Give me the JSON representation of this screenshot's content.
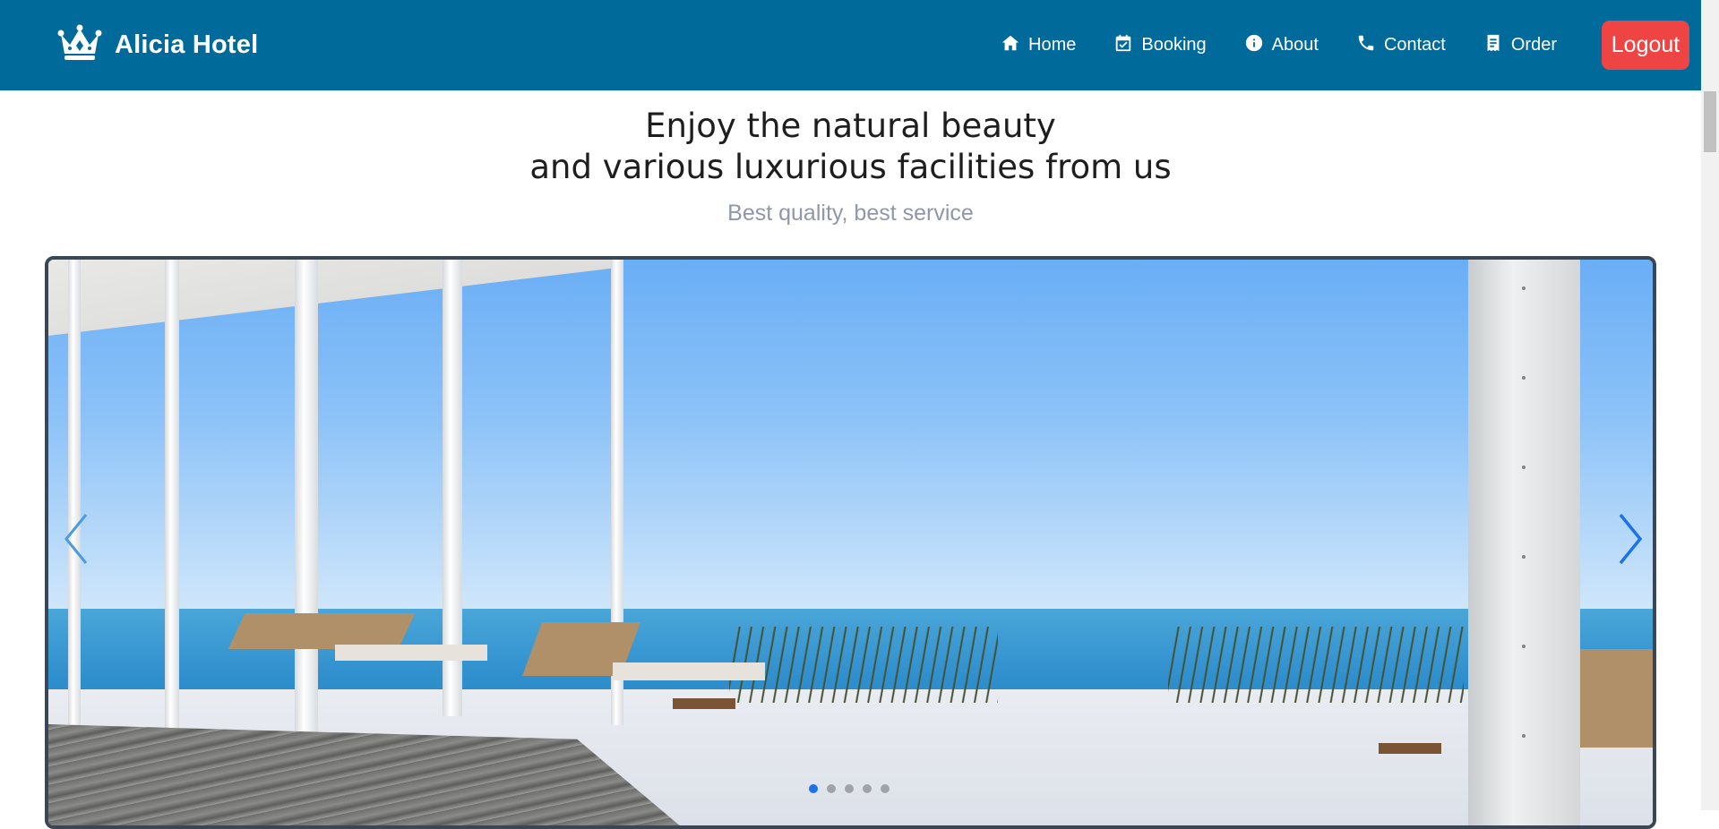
{
  "brand": {
    "name": "Alicia Hotel",
    "logo_icon": "crown-icon"
  },
  "nav": {
    "items": [
      {
        "label": "Home",
        "icon": "home-icon"
      },
      {
        "label": "Booking",
        "icon": "calendar-check-icon"
      },
      {
        "label": "About",
        "icon": "info-circle-icon"
      },
      {
        "label": "Contact",
        "icon": "phone-icon"
      },
      {
        "label": "Order",
        "icon": "receipt-icon"
      }
    ],
    "logout_label": "Logout"
  },
  "hero": {
    "title_line1": "Enjoy the natural beauty",
    "title_line2": "and various luxurious facilities from us",
    "subtitle": "Best quality, best service"
  },
  "carousel": {
    "slide_count": 5,
    "active_index": 0,
    "prev_icon": "chevron-left-icon",
    "next_icon": "chevron-right-icon"
  },
  "colors": {
    "navbar": "#006a9a",
    "logout": "#ef4444",
    "indicator_active": "#1a73e8",
    "subtitle": "#8e98a8"
  }
}
